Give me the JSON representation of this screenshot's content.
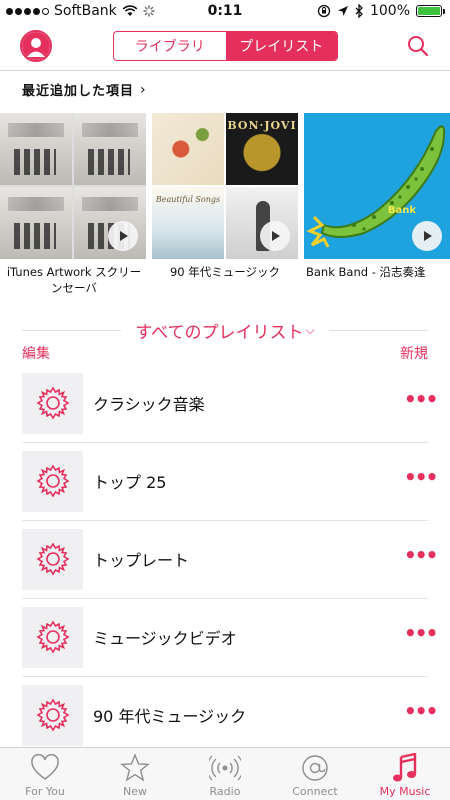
{
  "status_bar": {
    "carrier": "SoftBank",
    "time": "0:11",
    "battery": "100%"
  },
  "nav": {
    "segments": [
      "ライブラリ",
      "プレイリスト"
    ],
    "active_segment": "プレイリスト"
  },
  "recent": {
    "header": "最近追加した項目",
    "items": [
      {
        "title": "iTunes Artwork スクリーンセーバ"
      },
      {
        "title": "90 年代ミュージック"
      },
      {
        "title": "Bank Band - 沿志奏逢"
      }
    ],
    "art_text": {
      "bon_jovi": "BON·JOVI",
      "beautiful_songs": "Beautiful Songs",
      "bank": "Bank"
    }
  },
  "playlists": {
    "section_title": "すべてのプレイリスト",
    "edit_label": "編集",
    "new_label": "新規",
    "items": [
      {
        "name": "クラシック音楽"
      },
      {
        "name": "トップ 25"
      },
      {
        "name": "トップレート"
      },
      {
        "name": "ミュージックビデオ"
      },
      {
        "name": "90 年代ミュージック"
      }
    ],
    "more_glyph": "•••"
  },
  "tab_bar": {
    "tabs": [
      {
        "label": "For You",
        "icon": "heart-icon"
      },
      {
        "label": "New",
        "icon": "star-icon"
      },
      {
        "label": "Radio",
        "icon": "radio-icon"
      },
      {
        "label": "Connect",
        "icon": "at-icon"
      },
      {
        "label": "My Music",
        "icon": "music-note-icon"
      }
    ],
    "active_tab": "My Music"
  },
  "colors": {
    "accent": "#e5305d",
    "battery_green": "#3ec23e",
    "tab_inactive": "#8e8e93"
  }
}
